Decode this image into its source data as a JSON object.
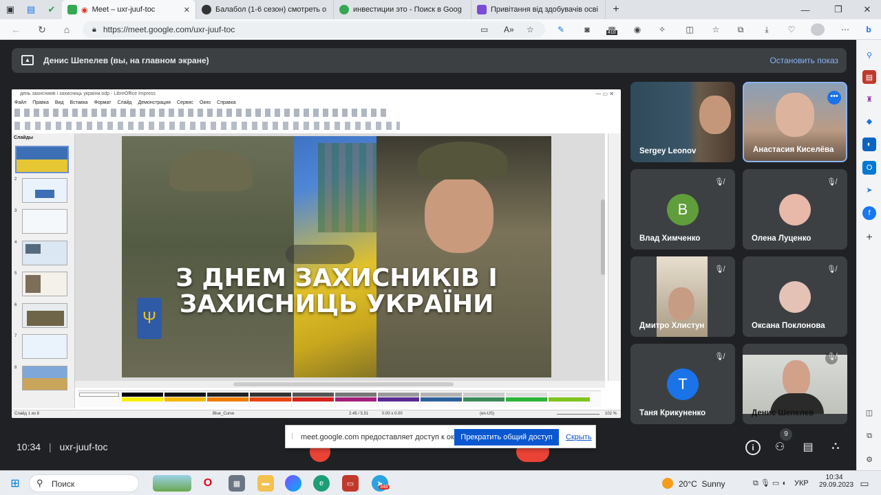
{
  "tabs": [
    {
      "title": "Meet – uxr-juuf-toc",
      "active": true,
      "color": "#1a73e8"
    },
    {
      "title": "Балабол (1-6 сезон) смотреть о",
      "active": false,
      "color": "#333333"
    },
    {
      "title": "инвестиции это - Поиск в Goog",
      "active": false,
      "color": "#34a853"
    },
    {
      "title": "Привітання від здобувачів осві",
      "active": false,
      "color": "#7b4bd6"
    }
  ],
  "browser": {
    "url": "https://meet.google.com/uxr-juuf-toc",
    "badge": "410"
  },
  "share": {
    "title": "Денис Шепелев (вы, на главном экране)",
    "stop": "Остановить показ"
  },
  "lo": {
    "title": "день захисників і захисниць україни.odp - LibreOffice Impress",
    "menu": [
      "Файл",
      "Правка",
      "Вид",
      "Вставка",
      "Формат",
      "Слайд",
      "Демонстрация",
      "Сервис",
      "Окно",
      "Справка"
    ],
    "slides_label": "Слайды",
    "slide_numbers": [
      "2",
      "3",
      "4",
      "5",
      "6",
      "7",
      "8"
    ],
    "status_left": "Слайд 1 из 8",
    "status_master": "Blue_Curve",
    "status_pos": "2.45 / 5.51",
    "status_size": "0.00 x 0.00",
    "status_lang": "(en-US)",
    "status_zoom": "102 %"
  },
  "slide": {
    "line1": "З ДНЕМ ЗАХИСНИКІВ І",
    "line2": "ЗАХИСНИЦЬ УКРАЇНИ"
  },
  "participants": [
    {
      "name": "Sergey Leonov",
      "type": "video",
      "muted": false
    },
    {
      "name": "Анастасия Киселёва",
      "type": "video",
      "muted": false,
      "highlight": true
    },
    {
      "name": "Влад Химченко",
      "type": "letter",
      "letter": "B",
      "color": "#5f9e3a",
      "muted": true
    },
    {
      "name": "Олена Луценко",
      "type": "photo",
      "color": "#e8b8a8",
      "muted": true
    },
    {
      "name": "Дмитро Хлистун",
      "type": "video",
      "muted": true
    },
    {
      "name": "Оксана Поклонова",
      "type": "photo",
      "color": "#e5c2b6",
      "muted": true
    },
    {
      "name": "Таня Крикуненко",
      "type": "letter",
      "letter": "T",
      "color": "#1a73e8",
      "muted": true
    },
    {
      "name": "Денис Шепелев",
      "type": "video",
      "muted": true
    }
  ],
  "bottom": {
    "time": "10:34",
    "sep": "|",
    "code": "uxr-juuf-toc",
    "people_count": "9"
  },
  "notify": {
    "text": "meet.google.com предоставляет доступ к окну.",
    "stop": "Прекратить общий доступ",
    "hide": "Скрыть"
  },
  "taskbar": {
    "search": "Поиск",
    "weather": "20°C  Sunny",
    "lang": "УКР",
    "time": "10:34",
    "date": "29.09.2023",
    "telegram_badge": "348"
  }
}
